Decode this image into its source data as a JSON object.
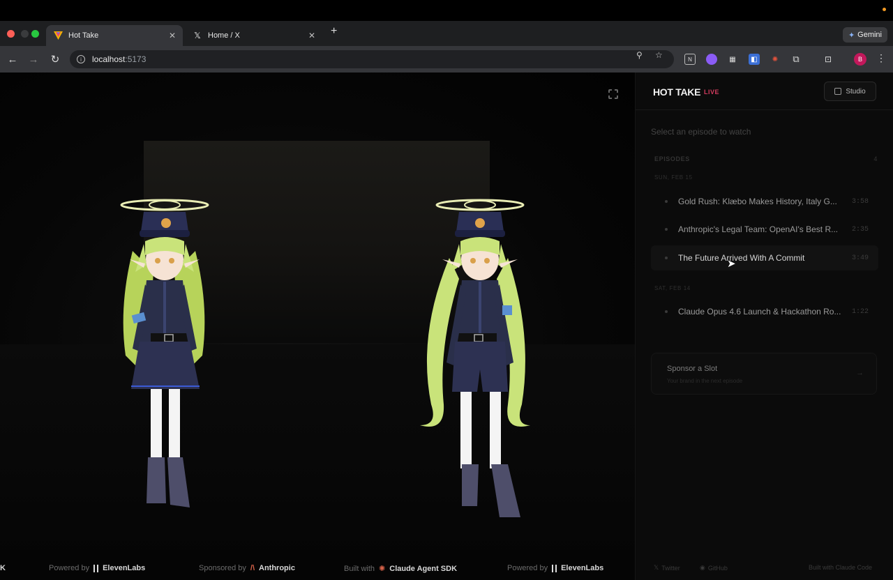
{
  "browser": {
    "tabs": [
      {
        "title": "Hot Take",
        "active": true,
        "icon": "hot-take-favicon"
      },
      {
        "title": "Home / X",
        "active": false,
        "icon": "x-logo-icon"
      }
    ],
    "gemini_label": "Gemini",
    "address": {
      "host": "localhost",
      "port": ":5173"
    }
  },
  "sidebar": {
    "brand": "HOT TAKE",
    "live_badge": "LIVE",
    "studio_label": "Studio",
    "select_hint": "Select an episode to watch",
    "episodes_heading": "EPISODES",
    "episodes_count": "4",
    "groups": [
      {
        "date": "SUN, FEB 15",
        "episodes": [
          {
            "title": "Gold Rush: Klæbo Makes History, Italy G...",
            "duration": "3:58"
          },
          {
            "title": "Anthropic's Legal Team: OpenAI's Best R...",
            "duration": "2:35"
          },
          {
            "title": "The Future Arrived With A Commit",
            "duration": "3:49"
          }
        ]
      },
      {
        "date": "SAT, FEB 14",
        "episodes": [
          {
            "title": "Claude Opus 4.6 Launch & Hackathon Ro...",
            "duration": "1:22"
          }
        ]
      }
    ],
    "sponsor": {
      "title": "Sponsor a Slot",
      "subtitle": "Your brand in the next episode",
      "arrow": "→"
    },
    "footer": {
      "twitter": "Twitter",
      "github": "GitHub",
      "built": "Built with Claude Code"
    }
  },
  "ticker": [
    {
      "prefix": "",
      "brand": "K"
    },
    {
      "prefix": "Powered by",
      "brand": "ElevenLabs",
      "icon": "elevenlabs-icon"
    },
    {
      "prefix": "Sponsored by",
      "brand": "Anthropic",
      "icon": "anthropic-icon"
    },
    {
      "prefix": "Built with",
      "brand": "Claude Agent SDK",
      "icon": "claude-icon"
    },
    {
      "prefix": "Powered by",
      "brand": "ElevenLabs",
      "icon": "elevenlabs-icon"
    }
  ],
  "colors": {
    "live": "#d23b5e",
    "hair": "#c9e37a",
    "uniform": "#2a2f4a",
    "halo": "#e9edb4"
  }
}
